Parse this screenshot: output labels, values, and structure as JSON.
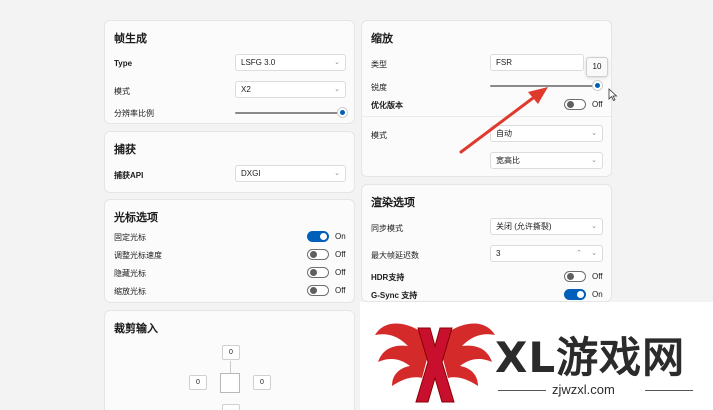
{
  "frame_gen": {
    "title": "帧生成",
    "type_label": "Type",
    "type_value": "LSFG 3.0",
    "mode_label": "模式",
    "mode_value": "X2",
    "resolution_label": "分辨率比例",
    "resolution_scale": 1.0
  },
  "capture": {
    "title": "捕获",
    "api_label": "捕获API",
    "api_value": "DXGI"
  },
  "cursor": {
    "title": "光标选项",
    "items": [
      {
        "label": "固定光标",
        "state": "On",
        "on": true
      },
      {
        "label": "调整光标速度",
        "state": "Off",
        "on": false
      },
      {
        "label": "隐藏光标",
        "state": "Off",
        "on": false
      },
      {
        "label": "缩放光标",
        "state": "Off",
        "on": false
      }
    ]
  },
  "crop": {
    "title": "裁剪输入",
    "top": "0",
    "left": "0",
    "right": "0"
  },
  "scaling": {
    "title": "缩放",
    "type_label": "类型",
    "type_value": "FSR",
    "sharpness_label": "锐度",
    "sharpness_value": "10",
    "sharpness_fraction": 1.0,
    "optimize_label": "优化版本",
    "optimize_state": "Off",
    "mode_label": "模式",
    "mode_value": "自动",
    "aspect_value": "宽高比"
  },
  "render": {
    "title": "渲染选项",
    "sync_label": "同步模式",
    "sync_value": "关闭 (允许撕裂)",
    "latency_label": "最大帧延迟数",
    "latency_value": "3",
    "hdr_label": "HDR支持",
    "hdr_state": "Off",
    "gsync_label": "G-Sync 支持",
    "gsync_state": "On"
  },
  "watermark": {
    "brand": "XL游戏网",
    "url": "zjwzxl.com"
  },
  "colors": {
    "accent": "#005fb8",
    "arrow": "#e03a2f"
  }
}
